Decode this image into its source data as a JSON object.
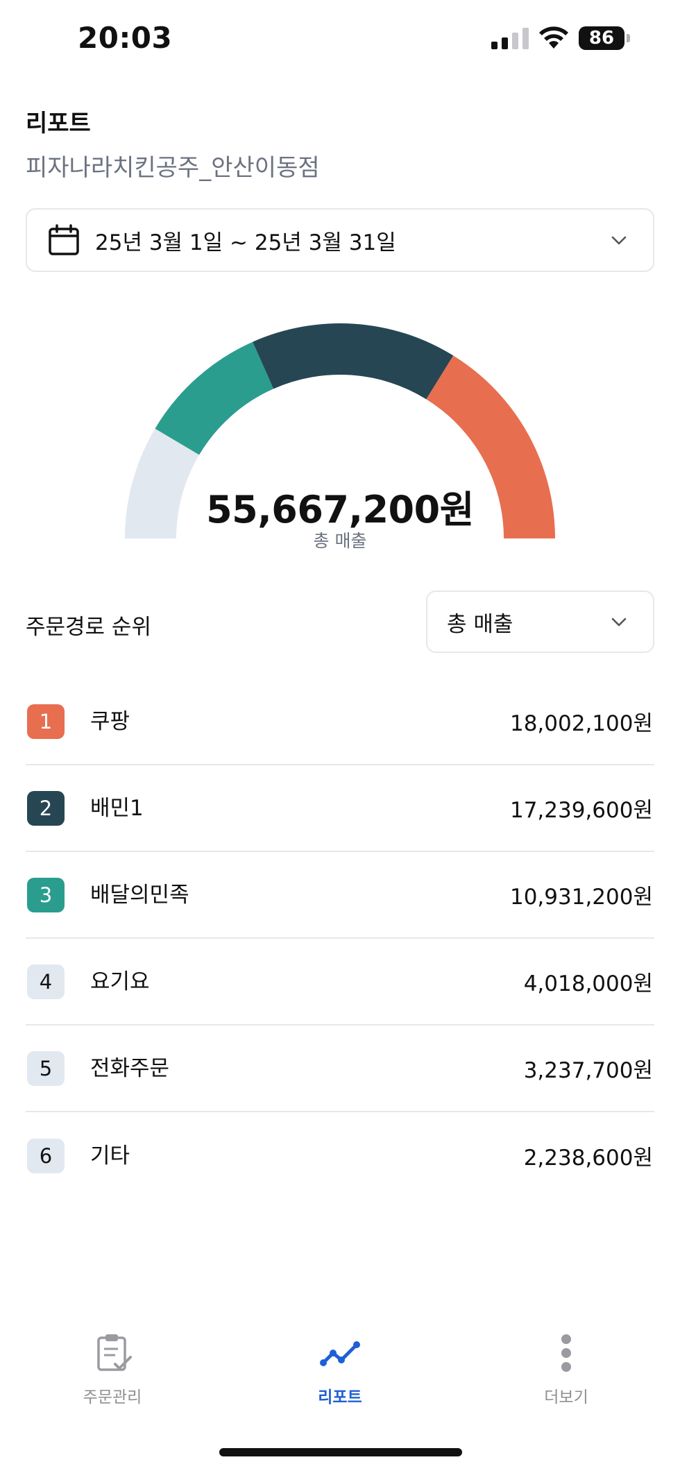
{
  "status_bar": {
    "time": "20:03",
    "battery": "86",
    "signal_icon": "cellular-signal-icon",
    "wifi_icon": "wifi-icon"
  },
  "header": {
    "title": "리포트",
    "store_name": "피자나라치킨공주_안산이동점"
  },
  "date_range": {
    "icon": "calendar-icon",
    "label": "25년 3월 1일 ~ 25년 3월 31일"
  },
  "summary": {
    "total_amount": "55,667,200원",
    "total_label": "총 매출"
  },
  "ranking": {
    "title": "주문경로 순위",
    "metric_selected": "총 매출",
    "rows": [
      {
        "rank": "1",
        "name": "쿠팡",
        "value": "18,002,100원",
        "amount": 18002100,
        "color": "#E86E50",
        "text_color": "#ffffff"
      },
      {
        "rank": "2",
        "name": "배민1",
        "value": "17,239,600원",
        "amount": 17239600,
        "color": "#264653",
        "text_color": "#ffffff"
      },
      {
        "rank": "3",
        "name": "배달의민족",
        "value": "10,931,200원",
        "amount": 10931200,
        "color": "#2A9D8F",
        "text_color": "#ffffff"
      },
      {
        "rank": "4",
        "name": "요기요",
        "value": "4,018,000원",
        "amount": 4018000,
        "color": "#E2E8F0",
        "text_color": "#111111"
      },
      {
        "rank": "5",
        "name": "전화주문",
        "value": "3,237,700원",
        "amount": 3237700,
        "color": "#E2E8F0",
        "text_color": "#111111"
      },
      {
        "rank": "6",
        "name": "기타",
        "value": "2,238,600원",
        "amount": 2238600,
        "color": "#E2E8F0",
        "text_color": "#111111"
      }
    ]
  },
  "nav": {
    "items": [
      {
        "label": "주문관리",
        "icon": "clipboard-check-icon",
        "active": false
      },
      {
        "label": "리포트",
        "icon": "line-chart-icon",
        "active": true
      },
      {
        "label": "더보기",
        "icon": "more-vertical-icon",
        "active": false
      }
    ],
    "active_color": "#1F5FD6",
    "inactive_color": "#8E8E93"
  }
}
